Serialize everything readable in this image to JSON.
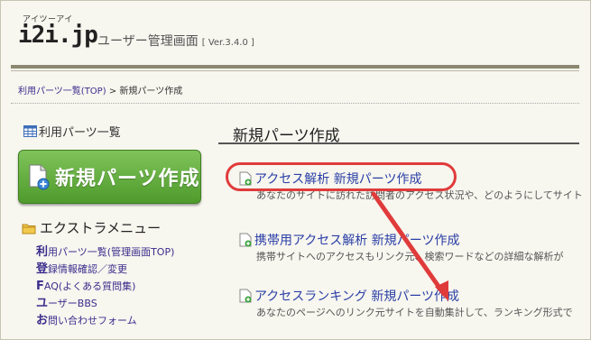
{
  "header": {
    "logo_kana": "アイツーアイ",
    "logo": "i2i.jp",
    "app_title": "ユーザー管理画面",
    "version": "[ Ver.3.4.0 ]"
  },
  "breadcrumb": {
    "link": "利用パーツ一覧(TOP)",
    "separator": ">",
    "current": "新規パーツ作成"
  },
  "sidebar": {
    "list_link": "利用パーツ一覧",
    "create_button": "新規パーツ作成",
    "extra_menu_title": "エクストラメニュー",
    "menu_items": [
      {
        "first": "利",
        "rest": "用パーツ一覧(管理画面TOP)"
      },
      {
        "first": "登",
        "rest": "録情報確認／変更"
      },
      {
        "first": "F",
        "rest": "AQ(よくある質問集)"
      },
      {
        "first": "ユ",
        "rest": "ーザーBBS"
      },
      {
        "first": "お",
        "rest": "問い合わせフォーム"
      }
    ]
  },
  "main": {
    "title": "新規パーツ作成",
    "entries": [
      {
        "label": "アクセス解析 新規パーツ作成",
        "desc": "あなたのサイトに訪れた訪問者のアクセス状況や、どのようにしてサイトに"
      },
      {
        "label": "携帯用アクセス解析 新規パーツ作成",
        "desc": "携帯サイトへのアクセスもリンク元、検索ワードなどの詳細な解析が"
      },
      {
        "label": "アクセスランキング 新規パーツ作成",
        "desc": "あなたのページへのリンク元サイトを自動集計して、ランキング形式で"
      }
    ]
  },
  "colors": {
    "highlight": "#e03b3b",
    "button_green": "#5aa834",
    "link": "#2b3fa6"
  }
}
